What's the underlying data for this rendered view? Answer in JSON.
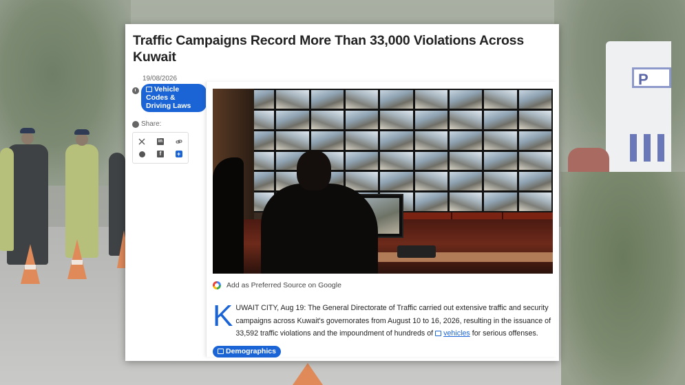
{
  "article": {
    "headline": "Traffic Campaigns Record More Than 33,000 Violations Across Kuwait",
    "date": "19/08/2026",
    "category_tag": "Vehicle Codes & Driving Laws",
    "share_label": "Share:",
    "google_source_label": "Add as Preferred Source on Google",
    "dropcap": "K",
    "body_lead": "UWAIT CITY, Aug 19: The General Directorate of Traffic carried out extensive traffic and security campaigns across Kuwait's governorates from August 10 to 16, 2026, resulting in the issuance of 33,592 traffic violations and the impoundment of hundreds of",
    "inline_link": "vehicles",
    "body_tail": "for serious offenses.",
    "bottom_tag": "Demographics"
  },
  "share_icons": [
    "x-icon",
    "linkedin-icon",
    "link-icon",
    "whatsapp-icon",
    "facebook-icon",
    "plus-icon"
  ],
  "background": {
    "van_logo_text": "P"
  },
  "colors": {
    "accent_blue": "#1b64d6",
    "card_bg": "#ffffff"
  }
}
